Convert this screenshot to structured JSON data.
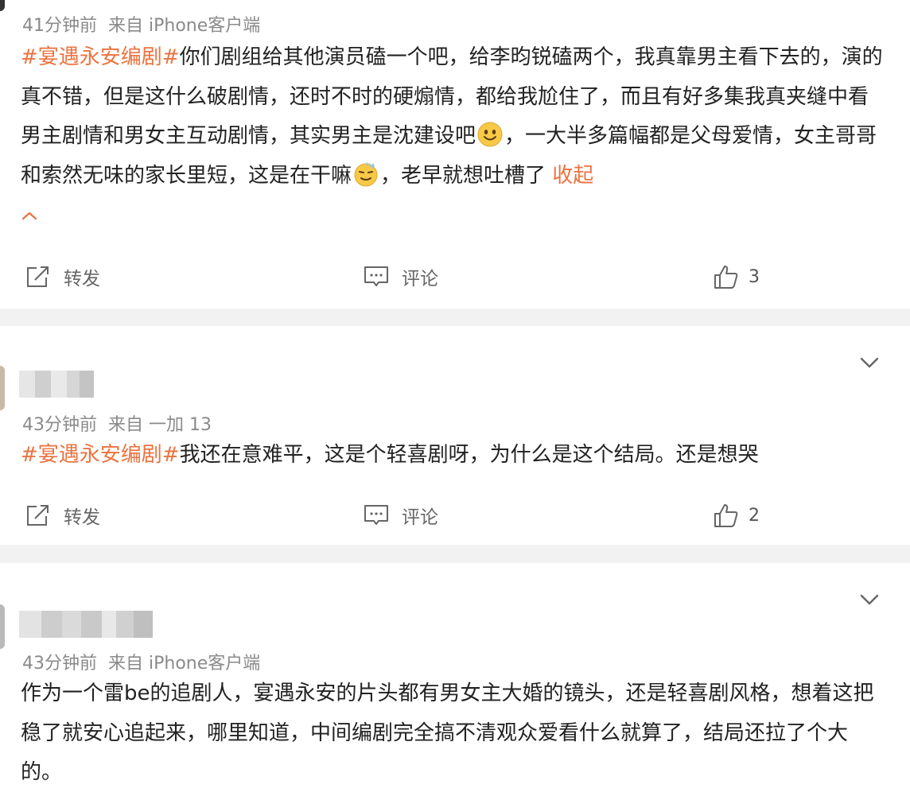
{
  "posts": [
    {
      "meta_time": "41分钟前",
      "meta_source": "来自 iPhone客户端",
      "topic": "#宴遇永安编剧#",
      "text_a": "你们剧组给其他演员磕一个吧，给李昀锐磕两个，我真靠男主看下去的，演的真不错，但是这什么破剧情，还时不时的硬煽情，都给我尬住了，而且有好多集我真夹缝中看男主剧情和男女主互动剧情，其实男主是沈建设吧",
      "text_b": "，一大半多篇幅都是父母爱情，女主哥哥和索然无味的家长里短，这是在干嘛",
      "text_c": "，老早就想吐槽了 ",
      "collapse": "收起",
      "emoji_1": "smile-emoji",
      "emoji_2": "sweat-emoji",
      "repost": "转发",
      "comment": "评论",
      "likes": "3"
    },
    {
      "meta_time": "43分钟前",
      "meta_source": "来自 一加 13",
      "topic": "#宴遇永安编剧#",
      "text_a": "我还在意难平，这是个轻喜剧呀，为什么是这个结局。还是想哭",
      "repost": "转发",
      "comment": "评论",
      "likes": "2"
    },
    {
      "meta_time": "43分钟前",
      "meta_source": "来自 iPhone客户端",
      "text_a": "作为一个雷be的追剧人，宴遇永安的片头都有男女主大婚的镜头，还是轻喜剧风格，想着这把稳了就安心追起来，哪里知道，中间编剧完全搞不清观众爱看什么就算了，结局还拉了个大的。"
    }
  ],
  "colors": {
    "topic": "#eb7340",
    "meta": "#8a8a8a",
    "text": "#222222",
    "separator": "#f2f2f2"
  }
}
